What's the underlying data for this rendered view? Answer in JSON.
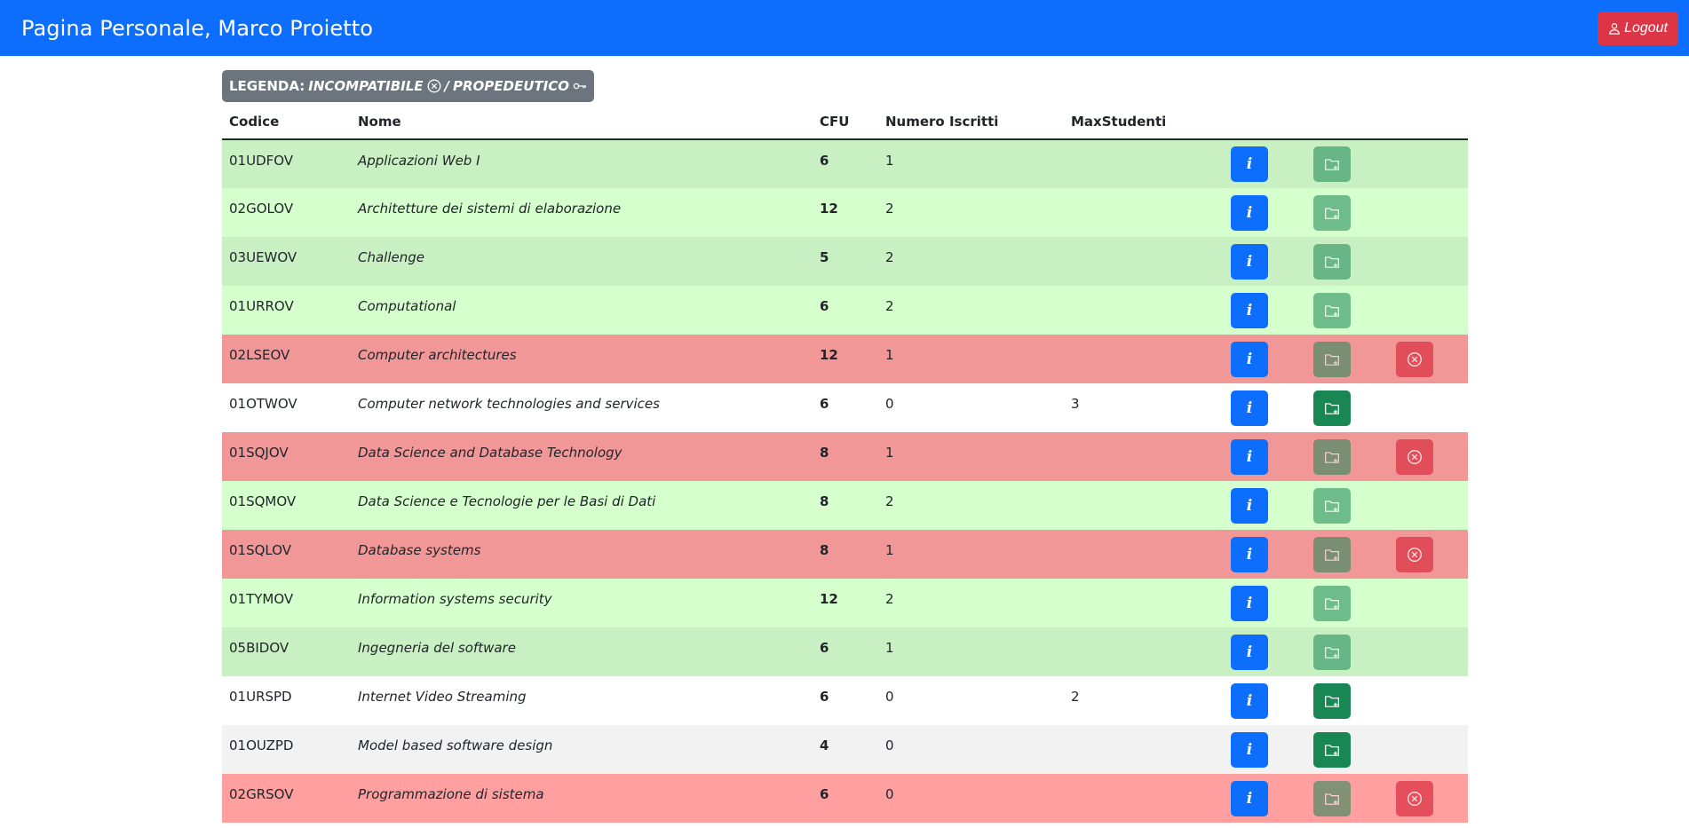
{
  "navbar": {
    "title": "Pagina Personale, Marco Proietto",
    "logout_label": "Logout"
  },
  "legend": {
    "prefix": "LEGENDA:",
    "incompatibile": "INCOMPATIBILE",
    "separator": "/",
    "propedeutico": "PROPEDEUTICO"
  },
  "table": {
    "headers": [
      "Codice",
      "Nome",
      "CFU",
      "Numero Iscritti",
      "MaxStudenti"
    ],
    "info_label": "i",
    "rows": [
      {
        "codice": "01UDFOV",
        "nome": "Applicazioni Web I",
        "cfu": "6",
        "iscritti": "1",
        "max": "",
        "status": "green-a",
        "add_enabled": false,
        "remove": false
      },
      {
        "codice": "02GOLOV",
        "nome": "Architetture dei sistemi di elaborazione",
        "cfu": "12",
        "iscritti": "2",
        "max": "",
        "status": "green-b",
        "add_enabled": false,
        "remove": false
      },
      {
        "codice": "03UEWOV",
        "nome": "Challenge",
        "cfu": "5",
        "iscritti": "2",
        "max": "",
        "status": "green-a",
        "add_enabled": false,
        "remove": false
      },
      {
        "codice": "01URROV",
        "nome": "Computational",
        "cfu": "6",
        "iscritti": "2",
        "max": "",
        "status": "green-b",
        "add_enabled": false,
        "remove": false
      },
      {
        "codice": "02LSEOV",
        "nome": "Computer architectures",
        "cfu": "12",
        "iscritti": "1",
        "max": "",
        "status": "red-a",
        "add_enabled": false,
        "remove": true
      },
      {
        "codice": "01OTWOV",
        "nome": "Computer network technologies and services",
        "cfu": "6",
        "iscritti": "0",
        "max": "3",
        "status": "white",
        "add_enabled": true,
        "remove": false
      },
      {
        "codice": "01SQJOV",
        "nome": "Data Science and Database Technology",
        "cfu": "8",
        "iscritti": "1",
        "max": "",
        "status": "red-a",
        "add_enabled": false,
        "remove": true
      },
      {
        "codice": "01SQMOV",
        "nome": "Data Science e Tecnologie per le Basi di Dati",
        "cfu": "8",
        "iscritti": "2",
        "max": "",
        "status": "green-b",
        "add_enabled": false,
        "remove": false
      },
      {
        "codice": "01SQLOV",
        "nome": "Database systems",
        "cfu": "8",
        "iscritti": "1",
        "max": "",
        "status": "red-a",
        "add_enabled": false,
        "remove": true
      },
      {
        "codice": "01TYMOV",
        "nome": "Information systems security",
        "cfu": "12",
        "iscritti": "2",
        "max": "",
        "status": "green-b",
        "add_enabled": false,
        "remove": false
      },
      {
        "codice": "05BIDOV",
        "nome": "Ingegneria del software",
        "cfu": "6",
        "iscritti": "1",
        "max": "",
        "status": "green-a",
        "add_enabled": false,
        "remove": false
      },
      {
        "codice": "01URSPD",
        "nome": "Internet Video Streaming",
        "cfu": "6",
        "iscritti": "0",
        "max": "2",
        "status": "white",
        "add_enabled": true,
        "remove": false
      },
      {
        "codice": "01OUZPD",
        "nome": "Model based software design",
        "cfu": "4",
        "iscritti": "0",
        "max": "",
        "status": "grey",
        "add_enabled": true,
        "remove": false
      },
      {
        "codice": "02GRSOV",
        "nome": "Programmazione di sistema",
        "cfu": "6",
        "iscritti": "0",
        "max": "",
        "status": "red-b",
        "add_enabled": false,
        "remove": true
      }
    ]
  }
}
